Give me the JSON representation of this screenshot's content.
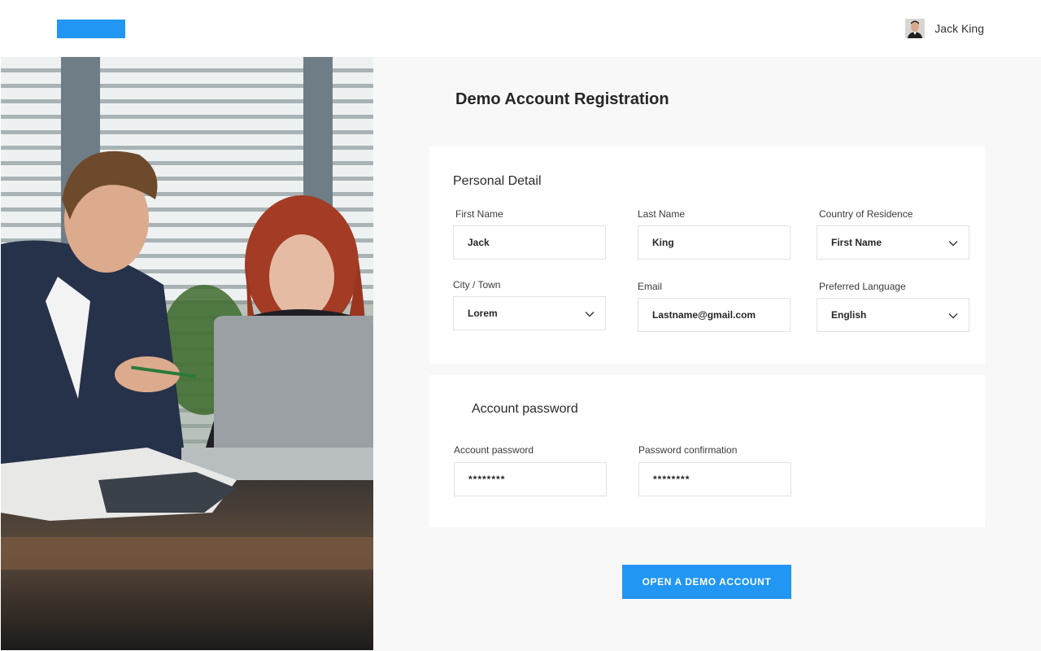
{
  "header": {
    "user_name": "Jack King"
  },
  "main": {
    "title": "Demo Account Registration"
  },
  "personal_detail": {
    "title": "Personal Detail",
    "first_name": {
      "label": "First Name",
      "value": "Jack"
    },
    "last_name": {
      "label": "Last Name",
      "value": "King"
    },
    "country": {
      "label": "Country of Residence",
      "value": "First Name"
    },
    "city": {
      "label": "City / Town",
      "value": "Lorem"
    },
    "email": {
      "label": "Email",
      "value": "Lastname@gmail.com"
    },
    "language": {
      "label": "Preferred Language",
      "value": "English"
    }
  },
  "account_password": {
    "title": "Account password",
    "password": {
      "label": "Account password",
      "value": "********"
    },
    "confirmation": {
      "label": "Password confirmation",
      "value": "********"
    }
  },
  "cta": {
    "label": "OPEN A DEMO ACCOUNT"
  },
  "icons": {
    "dropdown": "chevron-down-icon",
    "avatar": "user-avatar-photo"
  },
  "colors": {
    "accent": "#2196f3",
    "panel_background": "#f8f8f8",
    "card_background": "#ffffff",
    "field_border": "#e2e2e2"
  }
}
